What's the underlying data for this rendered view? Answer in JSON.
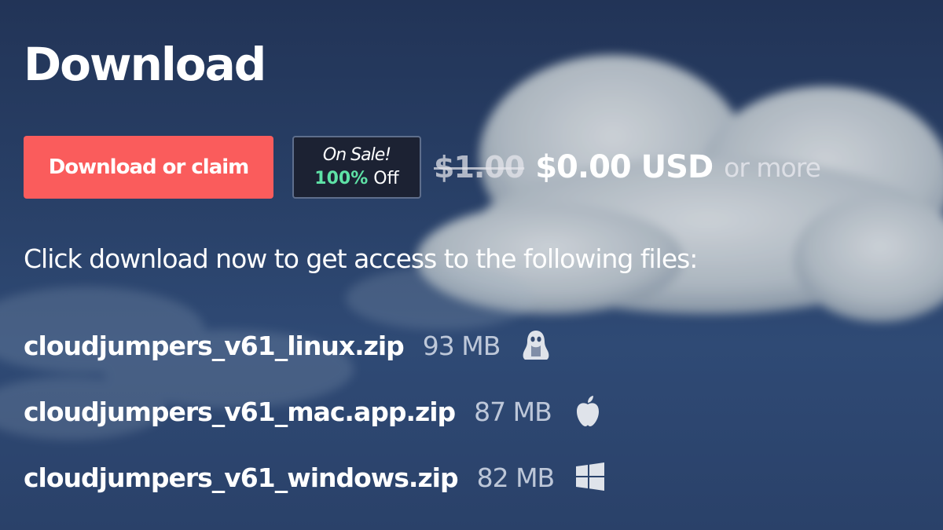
{
  "page": {
    "title": "Download"
  },
  "purchase": {
    "button_label": "Download or claim",
    "sale": {
      "label": "On Sale!",
      "percent": "100%",
      "off_text": "Off"
    },
    "original_price": "$1.00",
    "price": "$0.00 USD",
    "or_more": "or more"
  },
  "info_text": "Click download now to get access to the following files:",
  "files": [
    {
      "name": "cloudjumpers_v61_linux.zip",
      "size": "93 MB",
      "platform_icon": "linux-icon"
    },
    {
      "name": "cloudjumpers_v61_mac.app.zip",
      "size": "87 MB",
      "platform_icon": "apple-icon"
    },
    {
      "name": "cloudjumpers_v61_windows.zip",
      "size": "82 MB",
      "platform_icon": "windows-icon"
    }
  ],
  "colors": {
    "accent": "#fa5c5c",
    "sale_green": "#5ee2a6",
    "background": "#283f66"
  }
}
